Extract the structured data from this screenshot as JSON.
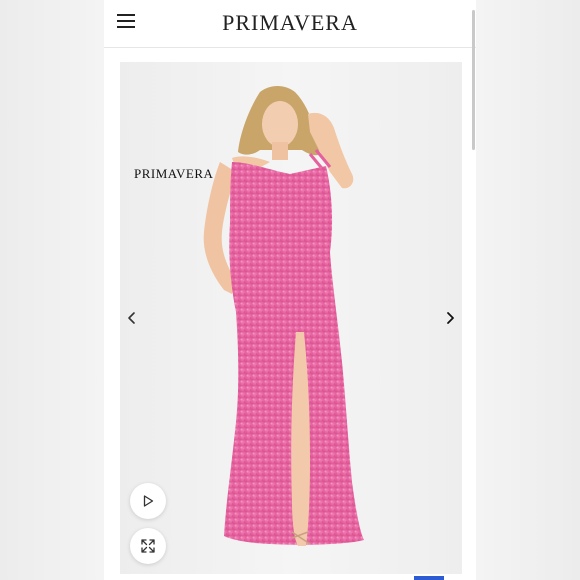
{
  "header": {
    "brand": "PRIMAVERA",
    "menu_icon": "hamburger-menu-icon"
  },
  "gallery": {
    "watermark": "PRIMAVERA",
    "product_color": "#e96aa3",
    "prev_icon": "chevron-left-icon",
    "next_icon": "chevron-right-icon",
    "play_icon": "play-icon",
    "expand_icon": "expand-icon"
  }
}
